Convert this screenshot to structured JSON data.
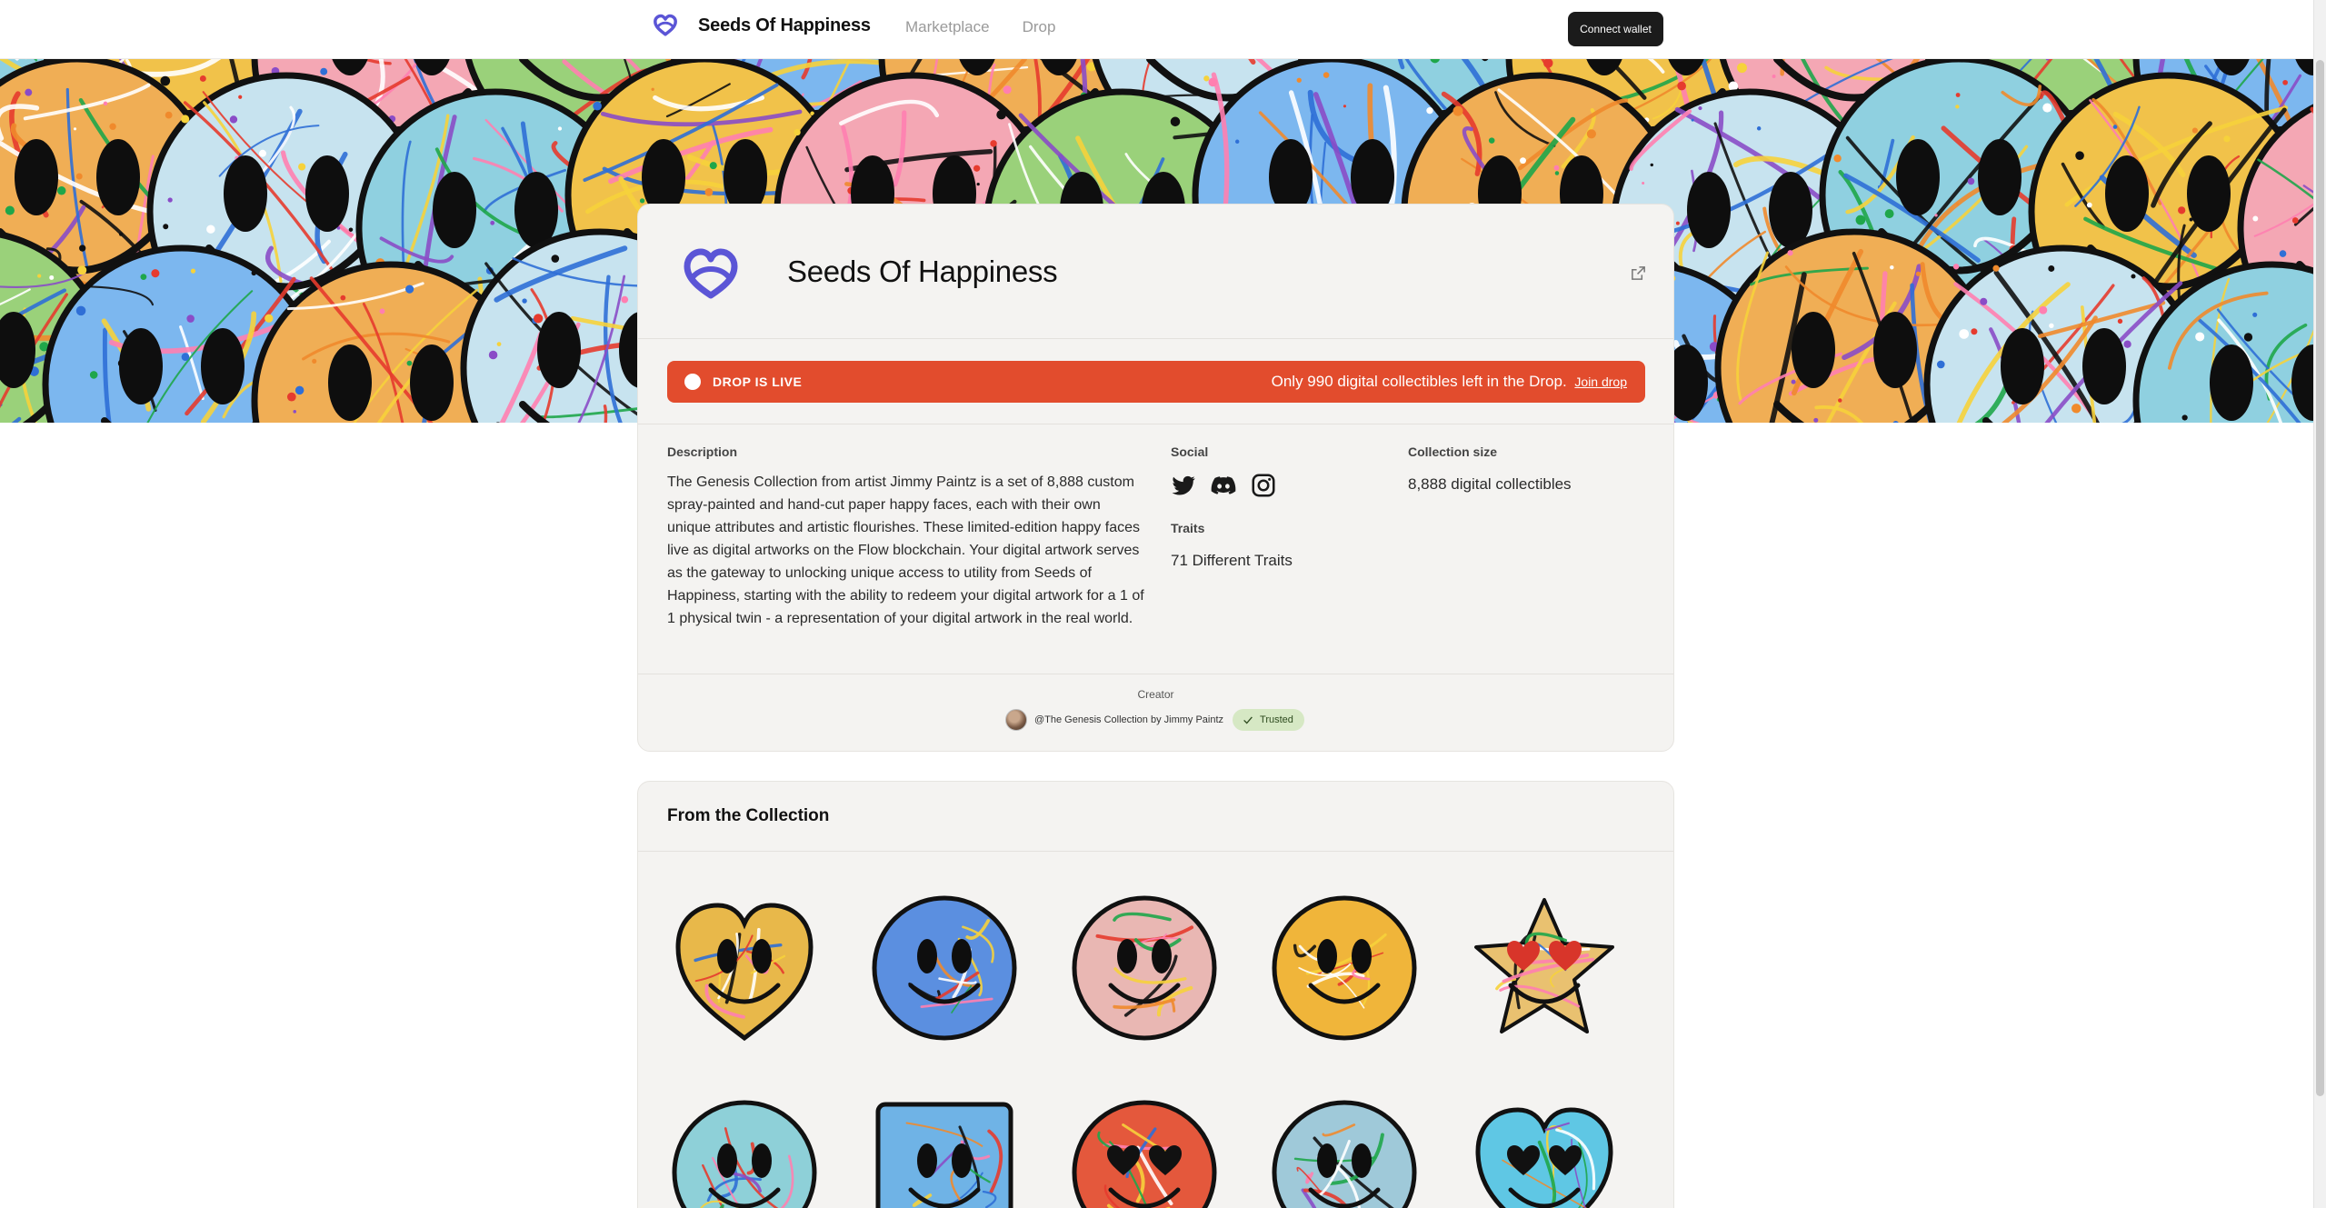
{
  "header": {
    "brand_name": "Seeds Of Happiness",
    "nav": [
      {
        "label": "Marketplace"
      },
      {
        "label": "Drop"
      }
    ],
    "connect_label": "Connect wallet"
  },
  "collection": {
    "title": "Seeds Of Happiness",
    "live_label": "DROP IS LIVE",
    "live_message": "Only 990 digital collectibles left in the Drop.",
    "join_label": "Join drop",
    "description_label": "Description",
    "description": "The Genesis Collection from artist Jimmy Paintz is a set of 8,888 custom spray-painted and hand-cut paper happy faces, each with their own unique attributes and artistic flourishes. These limited-edition happy faces live as digital artworks on the Flow blockchain. Your digital artwork serves as the gateway to unlocking unique access to utility from Seeds of Happiness, starting with the ability to redeem your digital artwork for a 1 of 1 physical twin - a representation of your digital artwork in the real world.",
    "social_label": "Social",
    "social_icons": [
      "twitter-icon",
      "discord-icon",
      "instagram-icon"
    ],
    "traits_label": "Traits",
    "traits_value": "71 Different Traits",
    "size_label": "Collection size",
    "size_value": "8,888 digital collectibles",
    "creator_label": "Creator",
    "creator_name": "@The Genesis Collection by Jimmy Paintz",
    "trusted_label": "Trusted"
  },
  "from_collection": {
    "title": "From the Collection",
    "items": [
      {
        "shape": "heart",
        "base": "#e8b84a"
      },
      {
        "shape": "circle",
        "base": "#5b8fe0"
      },
      {
        "shape": "circle",
        "base": "#e9b7b3"
      },
      {
        "shape": "circle",
        "base": "#f0b53a"
      },
      {
        "shape": "star",
        "base": "#e9c170"
      },
      {
        "shape": "circle",
        "base": "#8ed0d8"
      },
      {
        "shape": "square",
        "base": "#6fb3e6"
      },
      {
        "shape": "circle",
        "base": "#e4583c"
      },
      {
        "shape": "circle",
        "base": "#9fc9d9"
      },
      {
        "shape": "heart",
        "base": "#5fc7e4"
      }
    ]
  },
  "colors": {
    "accent": "#e24c2d",
    "logo": "#5b55d6",
    "trusted_bg": "#d6e8c4"
  }
}
